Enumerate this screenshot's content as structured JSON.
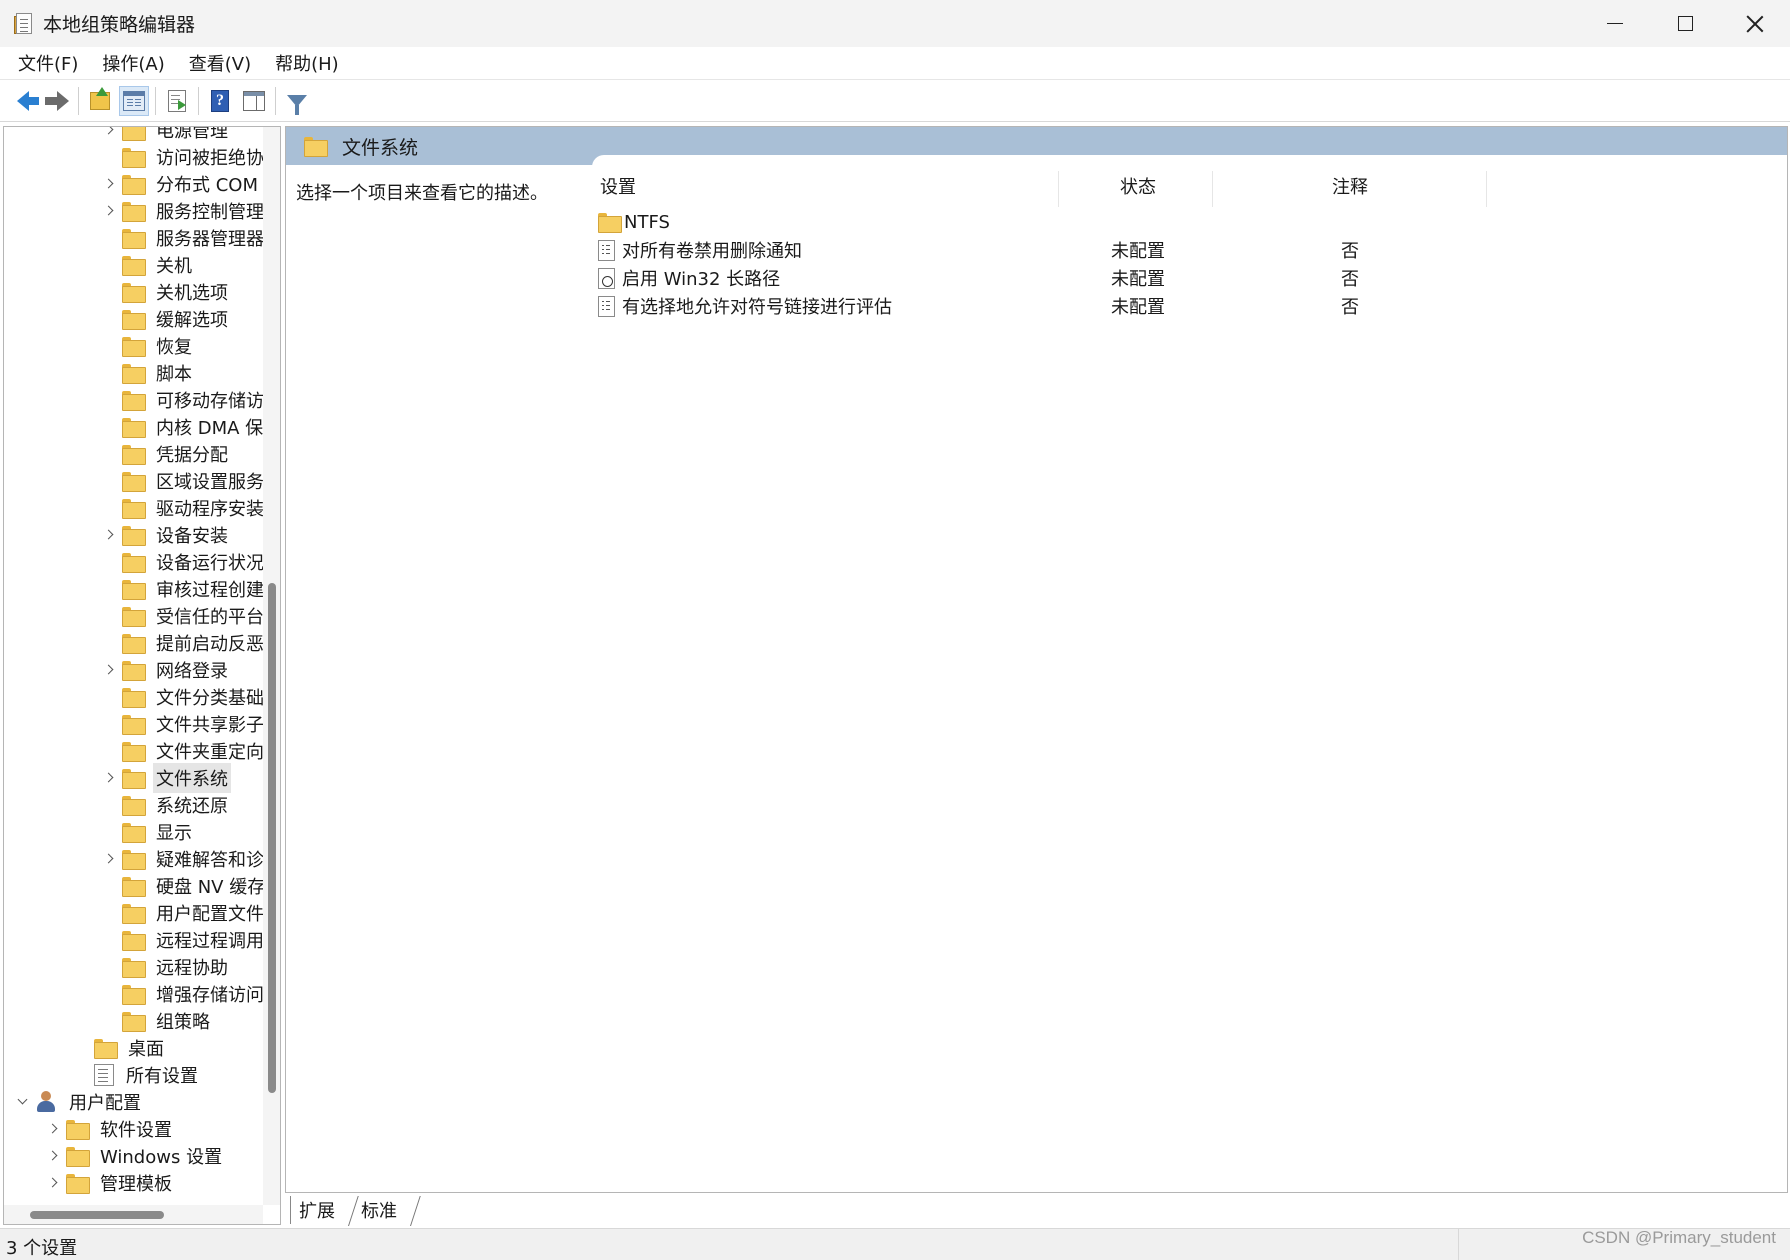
{
  "window": {
    "title": "本地组策略编辑器"
  },
  "menu": [
    "文件(F)",
    "操作(A)",
    "查看(V)",
    "帮助(H)"
  ],
  "toolbar": {
    "buttons": [
      "back-arrow-icon",
      "forward-arrow-icon",
      "up-folder-icon",
      "show-tree-icon",
      "export-list-icon",
      "help-icon",
      "properties-pane-icon",
      "filter-icon"
    ],
    "active": "show-tree-icon"
  },
  "tree": {
    "items": [
      {
        "label": "电源管理",
        "expand": true
      },
      {
        "label": "访问被拒绝协",
        "expand": false
      },
      {
        "label": "分布式 COM",
        "expand": true
      },
      {
        "label": "服务控制管理",
        "expand": true
      },
      {
        "label": "服务器管理器",
        "expand": false
      },
      {
        "label": "关机",
        "expand": false
      },
      {
        "label": "关机选项",
        "expand": false
      },
      {
        "label": "缓解选项",
        "expand": false
      },
      {
        "label": "恢复",
        "expand": false
      },
      {
        "label": "脚本",
        "expand": false
      },
      {
        "label": "可移动存储访",
        "expand": false
      },
      {
        "label": "内核 DMA 保",
        "expand": false
      },
      {
        "label": "凭据分配",
        "expand": false
      },
      {
        "label": "区域设置服务",
        "expand": false
      },
      {
        "label": "驱动程序安装",
        "expand": false
      },
      {
        "label": "设备安装",
        "expand": true
      },
      {
        "label": "设备运行状况",
        "expand": false
      },
      {
        "label": "审核过程创建",
        "expand": false
      },
      {
        "label": "受信任的平台",
        "expand": false
      },
      {
        "label": "提前启动反恶",
        "expand": false
      },
      {
        "label": "网络登录",
        "expand": true
      },
      {
        "label": "文件分类基础",
        "expand": false
      },
      {
        "label": "文件共享影子",
        "expand": false
      },
      {
        "label": "文件夹重定向",
        "expand": false
      },
      {
        "label": "文件系统",
        "expand": true,
        "selected": true
      },
      {
        "label": "系统还原",
        "expand": false
      },
      {
        "label": "显示",
        "expand": false
      },
      {
        "label": "疑难解答和诊",
        "expand": true
      },
      {
        "label": "硬盘 NV 缓存",
        "expand": false
      },
      {
        "label": "用户配置文件",
        "expand": false
      },
      {
        "label": "远程过程调用",
        "expand": false
      },
      {
        "label": "远程协助",
        "expand": false
      },
      {
        "label": "增强存储访问",
        "expand": false
      },
      {
        "label": "组策略",
        "expand": false
      }
    ],
    "desktop": "桌面",
    "all_settings": "所有设置",
    "user_config": "用户配置",
    "user_children": [
      {
        "label": "软件设置"
      },
      {
        "label": "Windows 设置"
      },
      {
        "label": "管理模板"
      }
    ]
  },
  "main": {
    "title": "文件系统",
    "description": "选择一个项目来查看它的描述。",
    "columns": {
      "setting": "设置",
      "state": "状态",
      "note": "注释"
    },
    "rows": [
      {
        "type": "folder",
        "name": "NTFS",
        "state": "",
        "note": ""
      },
      {
        "type": "policy",
        "name": "对所有卷禁用删除通知",
        "state": "未配置",
        "note": "否"
      },
      {
        "type": "policy-download",
        "name": "启用 Win32 长路径",
        "state": "未配置",
        "note": "否"
      },
      {
        "type": "policy",
        "name": "有选择地允许对符号链接进行评估",
        "state": "未配置",
        "note": "否"
      }
    ]
  },
  "tabs": [
    "扩展",
    "标准"
  ],
  "status": {
    "text": "3 个设置",
    "watermark": "CSDN @Primary_student"
  }
}
